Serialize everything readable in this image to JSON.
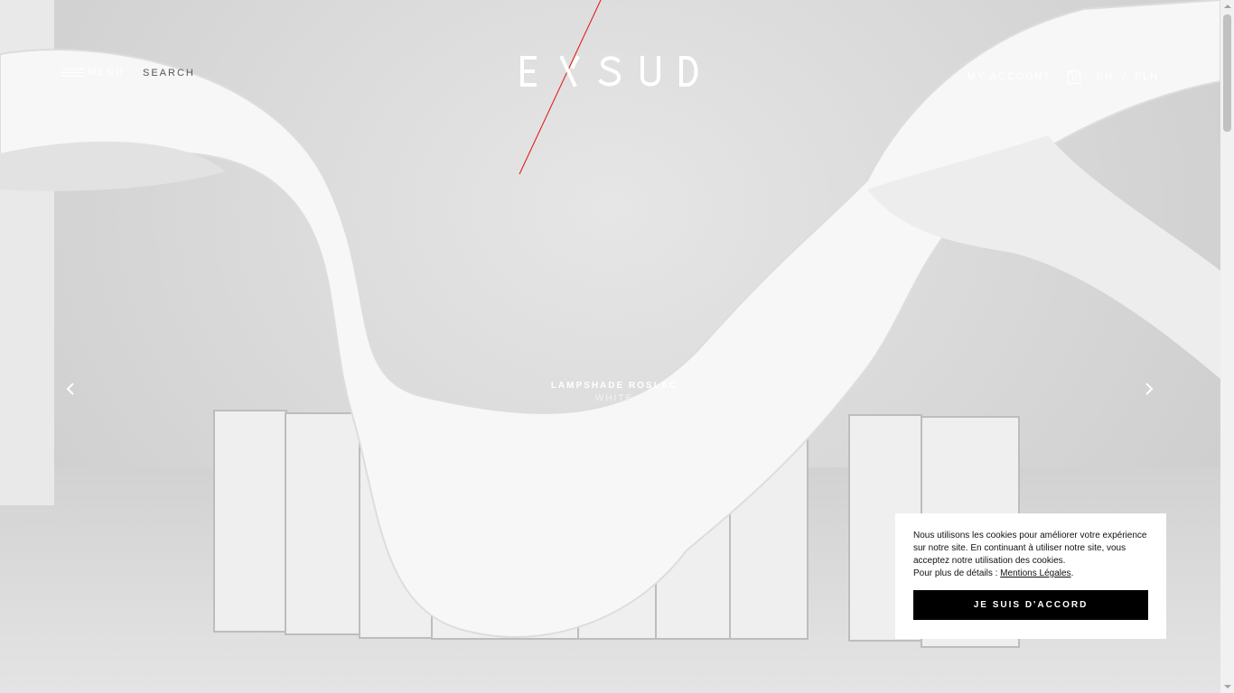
{
  "header": {
    "menu_label": "MENU",
    "search_label": "SEARCH",
    "logo_text": "EXSUD",
    "account_label": "MY ACCOUNT",
    "cart_count": "0",
    "lang_en": "EN",
    "lang_separator": "/",
    "lang_fr": "FLN"
  },
  "slide": {
    "title": "LAMPSHADE ROSLAC",
    "subtitle": "WHITE"
  },
  "cookie_banner": {
    "text_line": "Nous utilisons les cookies pour améliorer votre expérience sur notre site. En continuant à utiliser notre site, vous acceptez notre utilisation des cookies.",
    "details_prefix": "Pour plus de détails : ",
    "details_link": "Mentions Légales",
    "details_suffix": ".",
    "agree_label": "JE SUIS D'ACCORD"
  },
  "icons": {
    "menu": "hamburger-icon",
    "cart": "shopping-bag-icon",
    "prev": "chevron-left-icon",
    "next": "chevron-right-icon"
  },
  "colors": {
    "header_text": "#ffffff",
    "search_text": "#555555",
    "cookie_bg": "#ffffff",
    "button_bg": "#000000",
    "button_text": "#ffffff"
  }
}
